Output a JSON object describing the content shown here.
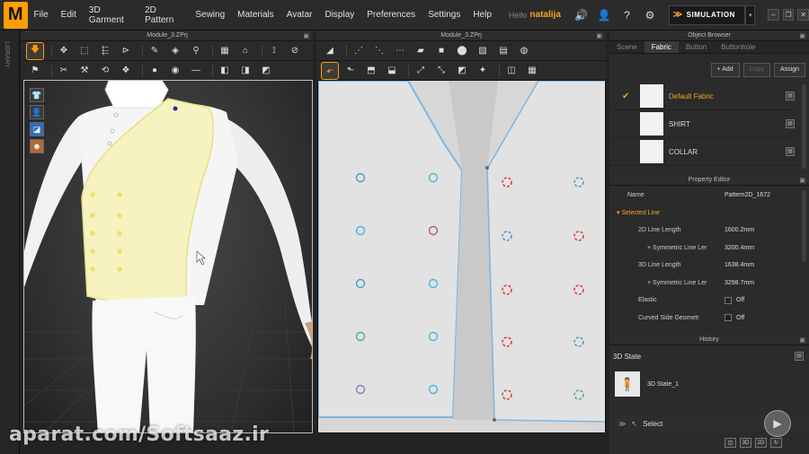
{
  "menubar": {
    "logo": "M",
    "items": [
      "File",
      "Edit",
      "3D Garment",
      "2D Pattern",
      "Sewing",
      "Materials",
      "Avatar",
      "Display",
      "Preferences",
      "Settings",
      "Help"
    ],
    "hello_label": "Hello",
    "username": "natalija",
    "simulation_label": "SIMULATION"
  },
  "left_tab": {
    "label": "LIBRARY"
  },
  "viewport3d": {
    "title": "Module_3.ZPrj"
  },
  "viewport2d": {
    "title": "Module_3.ZPrj"
  },
  "object_browser": {
    "title": "Object Browser",
    "tabs": [
      "Scene",
      "Fabric",
      "Button",
      "Buttonhole"
    ],
    "active_tab": "Fabric",
    "add_label": "+ Add",
    "copy_label": "Copy",
    "assign_label": "Assign",
    "fabrics": [
      {
        "name": "Default Fabric",
        "selected": true
      },
      {
        "name": "SHIRT",
        "selected": false
      },
      {
        "name": "COLLAR",
        "selected": false
      }
    ]
  },
  "property_editor": {
    "title": "Property Editor",
    "name_label": "Name",
    "name_value": "Pattern2D_1672",
    "section_label": "Selected Line",
    "rows": [
      {
        "label": "2D Line Length",
        "value": "1600.2mm"
      },
      {
        "label": "+ Symmetric Line Ler",
        "value": "3200.4mm"
      },
      {
        "label": "3D Line Length",
        "value": "1638.4mm"
      },
      {
        "label": "+ Symmetric Line Ler",
        "value": "3298.7mm"
      }
    ],
    "elastic_label": "Elastic",
    "elastic_value": "Off",
    "curved_label": "Curved Side Geometr",
    "curved_value": "Off"
  },
  "history": {
    "title": "History",
    "state_label": "3D State",
    "item_label": "3D State_1"
  },
  "bottom_bar": {
    "label": "Select"
  },
  "watermark": "aparat.com/Softsaaz.ir",
  "colors": {
    "accent": "#ff9d00",
    "selected_text": "#f5a623",
    "vest": "#f7f3c0",
    "pattern_line": "#7fb6e0"
  }
}
